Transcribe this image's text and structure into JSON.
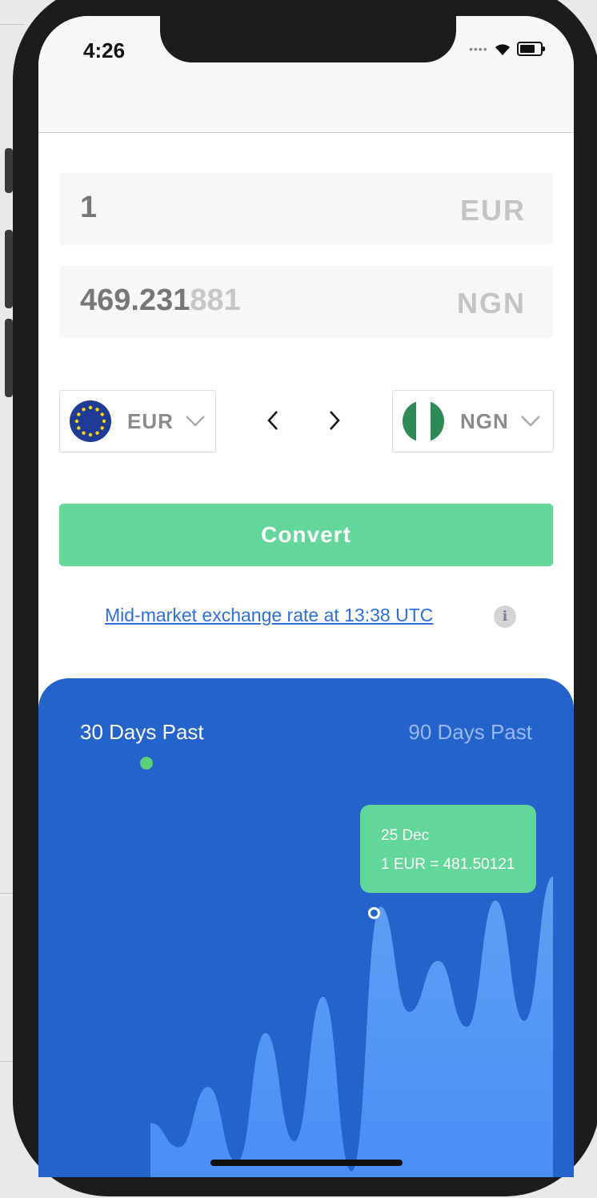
{
  "status_bar": {
    "time": "4:26"
  },
  "converter": {
    "amount": {
      "value": "1",
      "currency": "EUR"
    },
    "result": {
      "value_main": "469.231",
      "value_faded": "881",
      "currency": "NGN"
    },
    "from_currency": {
      "code": "EUR",
      "flag": "eu-flag-icon"
    },
    "to_currency": {
      "code": "NGN",
      "flag": "ng-flag-icon"
    },
    "convert_label": "Convert",
    "rate_link": "Mid-market exchange rate at 13:38 UTC",
    "info_icon_glyph": "i"
  },
  "chart": {
    "tabs": [
      "30 Days Past",
      "90 Days Past"
    ],
    "active_tab": "30 Days Past",
    "tooltip": {
      "date": "25 Dec",
      "rate": "1 EUR = 481.50121"
    },
    "colors": {
      "panel": "#2462cc",
      "area_top": "#5b9bf3",
      "area_bottom": "#4a8df5",
      "accent": "#63d69a"
    }
  },
  "chart_data": {
    "type": "area",
    "series": [
      {
        "values": [
          0.18,
          0.1,
          0.3,
          0.05,
          0.48,
          0.12,
          0.6,
          0.02,
          0.9,
          0.55,
          0.72,
          0.5,
          0.92,
          0.52,
          1.0
        ]
      }
    ]
  }
}
